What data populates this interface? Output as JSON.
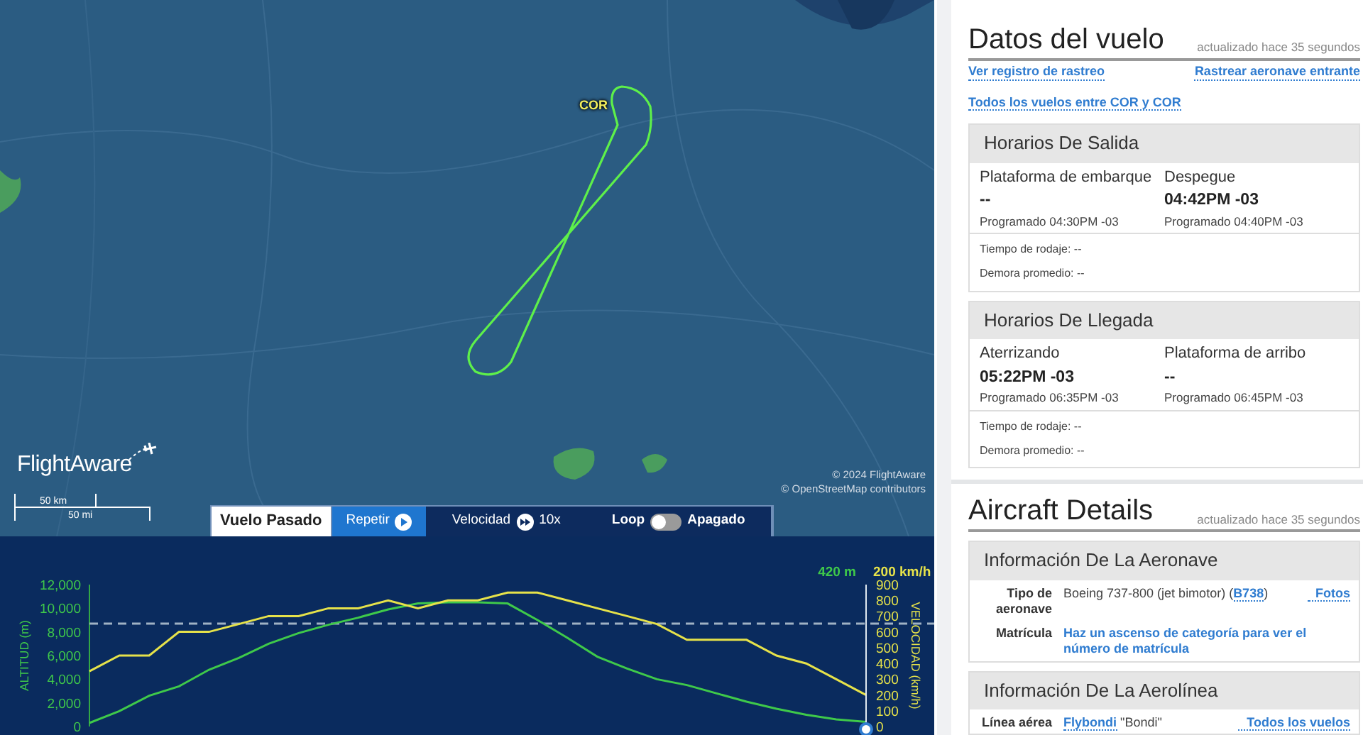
{
  "map": {
    "airport_label": "COR",
    "logo": "FlightAware",
    "scale": {
      "km": "50 km",
      "mi": "50 mi"
    },
    "attribution": [
      "© 2024 FlightAware",
      "© OpenStreetMap contributors"
    ]
  },
  "playback_bar": {
    "mode": "Vuelo Pasado",
    "replay": "Repetir",
    "speed_label": "Velocidad",
    "speed": "10x",
    "loop_label": "Loop",
    "loop": {
      "on": false,
      "state_text": "Apagado"
    }
  },
  "profile": {
    "altitude_readout": "420 m",
    "speed_readout": "200 km/h",
    "chart_data": {
      "type": "line",
      "ylabel": "ALTITUD (m)",
      "y2label": "VELOCIDAD (km/h)",
      "ylim": [
        0,
        12000
      ],
      "yticks": [
        0,
        {
          "value": 2000,
          "label": "2,000"
        },
        {
          "value": 4000,
          "label": "4,000"
        },
        {
          "value": 6000,
          "label": "6,000"
        },
        {
          "value": 8000,
          "label": "8,000"
        },
        {
          "value": 10000,
          "label": "10,000"
        },
        {
          "value": 12000,
          "label": "12,000"
        }
      ],
      "y2lim": [
        0,
        900
      ],
      "ref_lines": [
        {
          "axis": "y",
          "value": 8700
        }
      ],
      "y2ticks": [
        0,
        100,
        200,
        300,
        400,
        500,
        600,
        700,
        800,
        900
      ],
      "series": [
        {
          "color": "#3fc94a",
          "values": [
            300,
            1300,
            2600,
            3400,
            4800,
            5800,
            7000,
            7900,
            8600,
            9200,
            9900,
            10400,
            10500,
            10500,
            10400,
            9000,
            7500,
            5900,
            4900,
            4000,
            3500,
            2800,
            2100,
            1500,
            1000,
            600,
            400
          ]
        },
        {
          "color": "#e6e24a",
          "axis": "y2",
          "values": [
            350,
            450,
            450,
            600,
            600,
            650,
            700,
            700,
            750,
            750,
            800,
            750,
            800,
            800,
            850,
            850,
            800,
            750,
            700,
            650,
            550,
            550,
            550,
            450,
            400,
            300,
            200
          ]
        }
      ]
    }
  },
  "flight_data": {
    "title": "Datos del vuelo",
    "updated": "actualizado hace 35 segundos",
    "links": [
      "Ver registro de rastreo",
      "Rastrear aeronave entrante",
      "Todos los vuelos entre COR y COR"
    ],
    "sections": [
      {
        "title": "Horarios De Salida",
        "cells": [
          {
            "label": "Plataforma de embarque",
            "value": "--",
            "scheduled": "Programado 04:30PM -03"
          },
          {
            "label": "Despegue",
            "value": "04:42PM -03",
            "scheduled": "Programado 04:40PM -03"
          }
        ],
        "notes": [
          "Tiempo de rodaje: --",
          "Demora promedio: --"
        ]
      },
      {
        "title": "Horarios De Llegada",
        "cells": [
          {
            "label": "Aterrizando",
            "value": "05:22PM -03",
            "scheduled": "Programado 06:35PM -03"
          },
          {
            "label": "Plataforma de arribo",
            "value": "--",
            "scheduled": "Programado 06:45PM -03"
          }
        ],
        "notes": [
          "Tiempo de rodaje: --",
          "Demora promedio: --"
        ]
      }
    ]
  },
  "aircraft_details": {
    "title": "Aircraft Details",
    "updated": "actualizado hace 35 segundos",
    "sections": [
      {
        "title": "Información De La Aeronave",
        "rows": [
          {
            "label": "Tipo de aeronave",
            "parts": [
              {
                "text": "Boeing 737-800 (jet bimotor) (",
                "link": false
              },
              {
                "text": "B738",
                "link": true
              },
              {
                "text": ")",
                "link": false
              }
            ],
            "action": "Fotos"
          },
          {
            "label": "Matrícula",
            "parts": [
              {
                "text": "Haz un ascenso de categoría para ver el número de matrícula",
                "link": true
              }
            ]
          }
        ]
      },
      {
        "title": "Información De La Aerolínea",
        "rows": [
          {
            "label": "Línea aérea",
            "parts": [
              {
                "text": "Flybondi",
                "link": true
              },
              {
                "text": " \"Bondi\"",
                "link": false
              }
            ],
            "action": "Todos los vuelos"
          }
        ]
      }
    ]
  }
}
